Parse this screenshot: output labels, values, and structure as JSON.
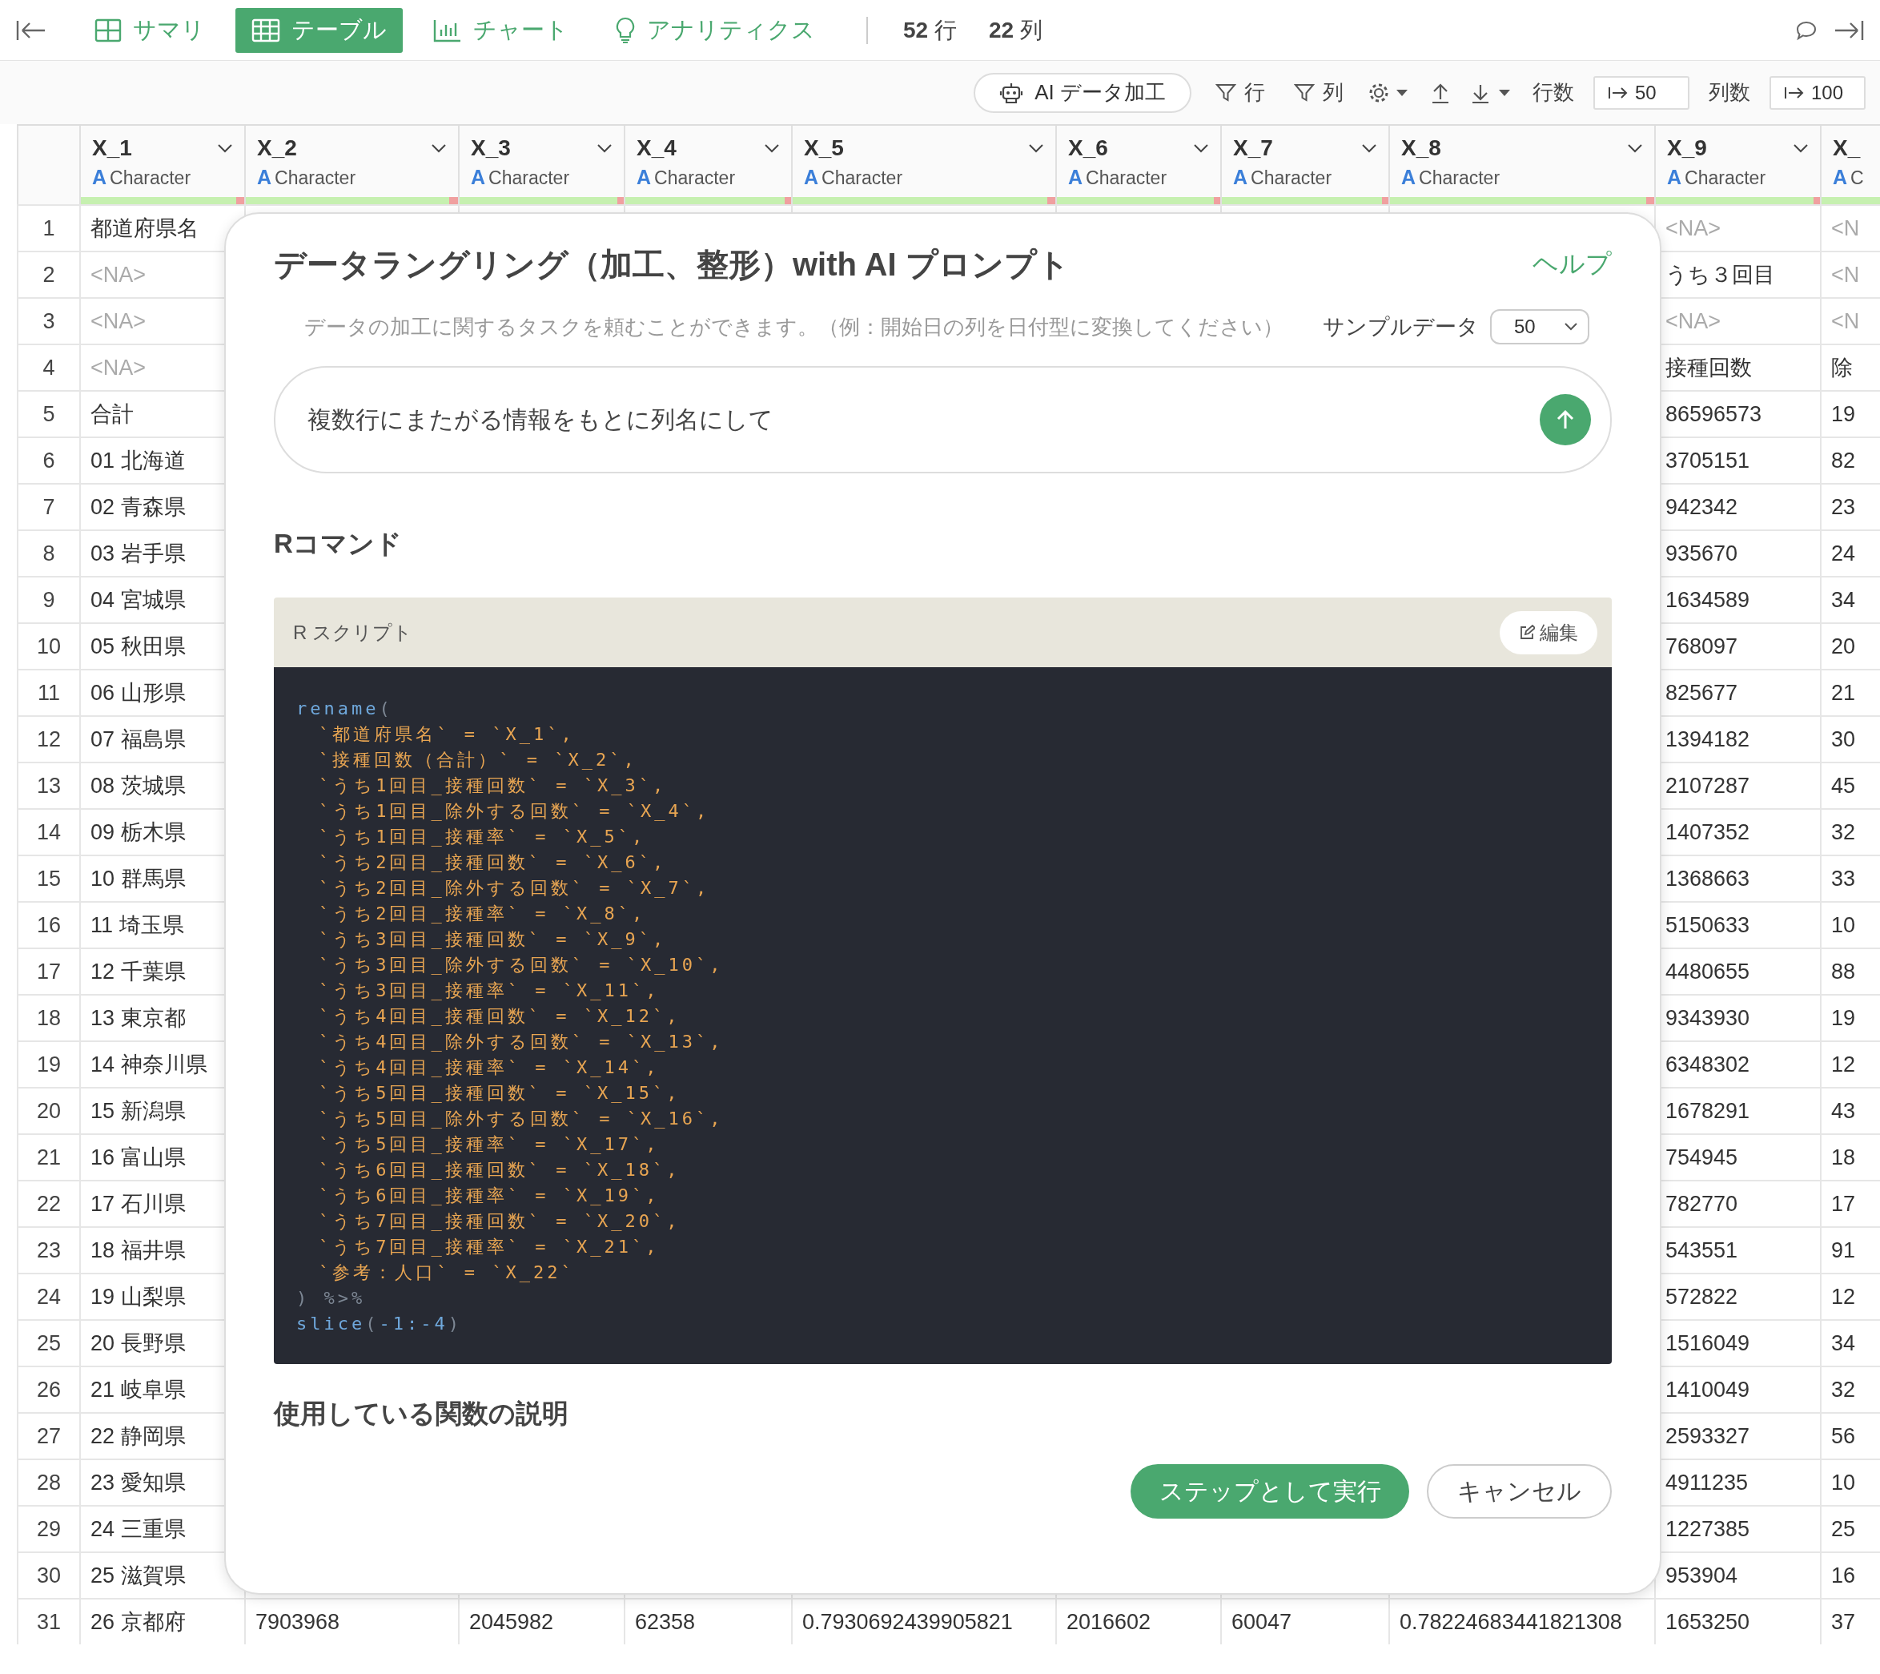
{
  "nav": {
    "tabs": [
      {
        "label": "サマリ",
        "kind": "summary",
        "selected": false
      },
      {
        "label": "テーブル",
        "kind": "table",
        "selected": true
      },
      {
        "label": "チャート",
        "kind": "chart",
        "selected": false
      },
      {
        "label": "アナリティクス",
        "kind": "analytics",
        "selected": false
      }
    ],
    "counts": [
      {
        "value": "52",
        "unit": "行"
      },
      {
        "value": "22",
        "unit": "列"
      }
    ]
  },
  "toolbar": {
    "ai_button": "AI データ加工",
    "row_filter": "行",
    "column_filter": "列",
    "row_count_label": "行数",
    "row_count": "50",
    "column_count_label": "列数",
    "column_count": "100"
  },
  "table": {
    "columns": [
      {
        "name": "X_1",
        "type_icon": "A",
        "type": "Character",
        "level": 0.95
      },
      {
        "name": "X_2",
        "type_icon": "A",
        "type": "Character",
        "level": 0.96
      },
      {
        "name": "X_3",
        "type_icon": "A",
        "type": "Character",
        "level": 0.96
      },
      {
        "name": "X_4",
        "type_icon": "A",
        "type": "Character",
        "level": 0.96
      },
      {
        "name": "X_5",
        "type_icon": "A",
        "type": "Character",
        "level": 0.97
      },
      {
        "name": "X_6",
        "type_icon": "A",
        "type": "Character",
        "level": 0.96
      },
      {
        "name": "X_7",
        "type_icon": "A",
        "type": "Character",
        "level": 0.96
      },
      {
        "name": "X_8",
        "type_icon": "A",
        "type": "Character",
        "level": 0.97
      },
      {
        "name": "X_9",
        "type_icon": "A",
        "type": "Character",
        "level": 0.96
      },
      {
        "name": "X_",
        "type_icon": "A",
        "type": "C",
        "level": 1
      }
    ],
    "rows": [
      {
        "number": "1",
        "x_1": "都道府県名",
        "x_9": {
          "text": "<NA>",
          "missing": true
        },
        "x_10": {
          "text": "<N",
          "missing": true
        }
      },
      {
        "number": "2",
        "x_1": {
          "text": "<NA>",
          "missing": true
        },
        "x_9": "うち３回目",
        "x_10": {
          "text": "<N",
          "missing": true
        }
      },
      {
        "number": "3",
        "x_1": {
          "text": "<NA>",
          "missing": true
        },
        "x_9": {
          "text": "<NA>",
          "missing": true
        },
        "x_10": {
          "text": "<N",
          "missing": true
        }
      },
      {
        "number": "4",
        "x_1": {
          "text": "<NA>",
          "missing": true
        },
        "x_9": "接種回数",
        "x_10": "除"
      },
      {
        "number": "5",
        "x_1": "合計",
        "x_9": "86596573",
        "x_10": "19"
      },
      {
        "number": "6",
        "x_1": "01 北海道",
        "x_9": "3705151",
        "x_10": "82"
      },
      {
        "number": "7",
        "x_1": "02 青森県",
        "x_9": "942342",
        "x_10": "23"
      },
      {
        "number": "8",
        "x_1": "03 岩手県",
        "x_9": "935670",
        "x_10": "24"
      },
      {
        "number": "9",
        "x_1": "04 宮城県",
        "x_9": "1634589",
        "x_10": "34"
      },
      {
        "number": "10",
        "x_1": "05 秋田県",
        "x_9": "768097",
        "x_10": "20"
      },
      {
        "number": "11",
        "x_1": "06 山形県",
        "x_9": "825677",
        "x_10": "21"
      },
      {
        "number": "12",
        "x_1": "07 福島県",
        "x_9": "1394182",
        "x_10": "30"
      },
      {
        "number": "13",
        "x_1": "08 茨城県",
        "x_9": "2107287",
        "x_10": "45"
      },
      {
        "number": "14",
        "x_1": "09 栃木県",
        "x_9": "1407352",
        "x_10": "32"
      },
      {
        "number": "15",
        "x_1": "10 群馬県",
        "x_9": "1368663",
        "x_10": "33"
      },
      {
        "number": "16",
        "x_1": "11 埼玉県",
        "x_9": "5150633",
        "x_10": "10"
      },
      {
        "number": "17",
        "x_1": "12 千葉県",
        "x_9": "4480655",
        "x_10": "88"
      },
      {
        "number": "18",
        "x_1": "13 東京都",
        "x_9": "9343930",
        "x_10": "19"
      },
      {
        "number": "19",
        "x_1": "14 神奈川県",
        "x_9": "6348302",
        "x_10": "12"
      },
      {
        "number": "20",
        "x_1": "15 新潟県",
        "x_9": "1678291",
        "x_10": "43"
      },
      {
        "number": "21",
        "x_1": "16 富山県",
        "x_9": "754945",
        "x_10": "18"
      },
      {
        "number": "22",
        "x_1": "17 石川県",
        "x_9": "782770",
        "x_10": "17"
      },
      {
        "number": "23",
        "x_1": "18 福井県",
        "x_9": "543551",
        "x_10": "91"
      },
      {
        "number": "24",
        "x_1": "19 山梨県",
        "x_9": "572822",
        "x_10": "12"
      },
      {
        "number": "25",
        "x_1": "20 長野県",
        "x_9": "1516049",
        "x_10": "34"
      },
      {
        "number": "26",
        "x_1": "21 岐阜県",
        "x_9": "1410049",
        "x_10": "32"
      },
      {
        "number": "27",
        "x_1": "22 静岡県",
        "x_9": "2593327",
        "x_10": "56"
      },
      {
        "number": "28",
        "x_1": "23 愛知県",
        "x_9": "4911235",
        "x_10": "10"
      },
      {
        "number": "29",
        "x_1": "24 三重県",
        "x_9": "1227385",
        "x_10": "25"
      },
      {
        "number": "30",
        "x_1": "25 滋賀県",
        "x_9": "953904",
        "x_10": "16"
      },
      {
        "number": "31",
        "x_1": "26 京都府",
        "x_2": "7903968",
        "x_3": "2045982",
        "x_4": "62358",
        "x_5": "0.7930692439905821",
        "x_6": "2016602",
        "x_7": "60047",
        "x_8": "0.78224683441821308",
        "x_9": "1653250",
        "x_10": "37"
      }
    ]
  },
  "dialog": {
    "title": "データラングリング（加工、整形）with AI プロンプト",
    "help_link": "ヘルプ",
    "description": "データの加工に関するタスクを頼むことができます。（例：開始日の列を日付型に変換してください）",
    "sample_label": "サンプルデータ",
    "sample_value": "50",
    "prompt": "複数行にまたがる情報をもとに列名にして",
    "r_heading": "Rコマンド",
    "script": {
      "title": "R スクリプト",
      "edit_button": "編集",
      "lines": [
        {
          "kind": "call",
          "segments": [
            {
              "text": "rename",
              "kind": "fn"
            },
            {
              "text": "(",
              "kind": "punct"
            }
          ]
        },
        {
          "kind": "arg",
          "segments": [
            {
              "text": "`都道府県名` = `X_1`,",
              "kind": "str"
            }
          ]
        },
        {
          "kind": "arg",
          "segments": [
            {
              "text": "`接種回数（合計）` = `X_2`,",
              "kind": "str"
            }
          ]
        },
        {
          "kind": "arg",
          "segments": [
            {
              "text": "`うち1回目_接種回数` = `X_3`,",
              "kind": "str"
            }
          ]
        },
        {
          "kind": "arg",
          "segments": [
            {
              "text": "`うち1回目_除外する回数` = `X_4`,",
              "kind": "str"
            }
          ]
        },
        {
          "kind": "arg",
          "segments": [
            {
              "text": "`うち1回目_接種率` = `X_5`,",
              "kind": "str"
            }
          ]
        },
        {
          "kind": "arg",
          "segments": [
            {
              "text": "`うち2回目_接種回数` = `X_6`,",
              "kind": "str"
            }
          ]
        },
        {
          "kind": "arg",
          "segments": [
            {
              "text": "`うち2回目_除外する回数` = `X_7`,",
              "kind": "str"
            }
          ]
        },
        {
          "kind": "arg",
          "segments": [
            {
              "text": "`うち2回目_接種率` = `X_8`,",
              "kind": "str"
            }
          ]
        },
        {
          "kind": "arg",
          "segments": [
            {
              "text": "`うち3回目_接種回数` = `X_9`,",
              "kind": "str"
            }
          ]
        },
        {
          "kind": "arg",
          "segments": [
            {
              "text": "`うち3回目_除外する回数` = `X_10`,",
              "kind": "str"
            }
          ]
        },
        {
          "kind": "arg",
          "segments": [
            {
              "text": "`うち3回目_接種率` = `X_11`,",
              "kind": "str"
            }
          ]
        },
        {
          "kind": "arg",
          "segments": [
            {
              "text": "`うち4回目_接種回数` = `X_12`,",
              "kind": "str"
            }
          ]
        },
        {
          "kind": "arg",
          "segments": [
            {
              "text": "`うち4回目_除外する回数` = `X_13`,",
              "kind": "str"
            }
          ]
        },
        {
          "kind": "arg",
          "segments": [
            {
              "text": "`うち4回目_接種率` = `X_14`,",
              "kind": "str"
            }
          ]
        },
        {
          "kind": "arg",
          "segments": [
            {
              "text": "`うち5回目_接種回数` = `X_15`,",
              "kind": "str"
            }
          ]
        },
        {
          "kind": "arg",
          "segments": [
            {
              "text": "`うち5回目_除外する回数` = `X_16`,",
              "kind": "str"
            }
          ]
        },
        {
          "kind": "arg",
          "segments": [
            {
              "text": "`うち5回目_接種率` = `X_17`,",
              "kind": "str"
            }
          ]
        },
        {
          "kind": "arg",
          "segments": [
            {
              "text": "`うち6回目_接種回数` = `X_18`,",
              "kind": "str"
            }
          ]
        },
        {
          "kind": "arg",
          "segments": [
            {
              "text": "`うち6回目_接種率` = `X_19`,",
              "kind": "str"
            }
          ]
        },
        {
          "kind": "arg",
          "segments": [
            {
              "text": "`うち7回目_接種回数` = `X_20`,",
              "kind": "str"
            }
          ]
        },
        {
          "kind": "arg",
          "segments": [
            {
              "text": "`うち7回目_接種率` = `X_21`,",
              "kind": "str"
            }
          ]
        },
        {
          "kind": "arg",
          "segments": [
            {
              "text": "`参考：人口` = `X_22`",
              "kind": "str"
            }
          ]
        },
        {
          "kind": "call",
          "segments": [
            {
              "text": ") %>%",
              "kind": "punct"
            }
          ]
        },
        {
          "kind": "call",
          "segments": [
            {
              "text": "slice",
              "kind": "fn"
            },
            {
              "text": "(",
              "kind": "punct"
            },
            {
              "text": "-1:-4",
              "kind": "num"
            },
            {
              "text": ")",
              "kind": "punct"
            }
          ]
        }
      ]
    },
    "functions_heading": "使用している関数の説明",
    "run_button": "ステップとして実行",
    "cancel_button": "キャンセル"
  }
}
